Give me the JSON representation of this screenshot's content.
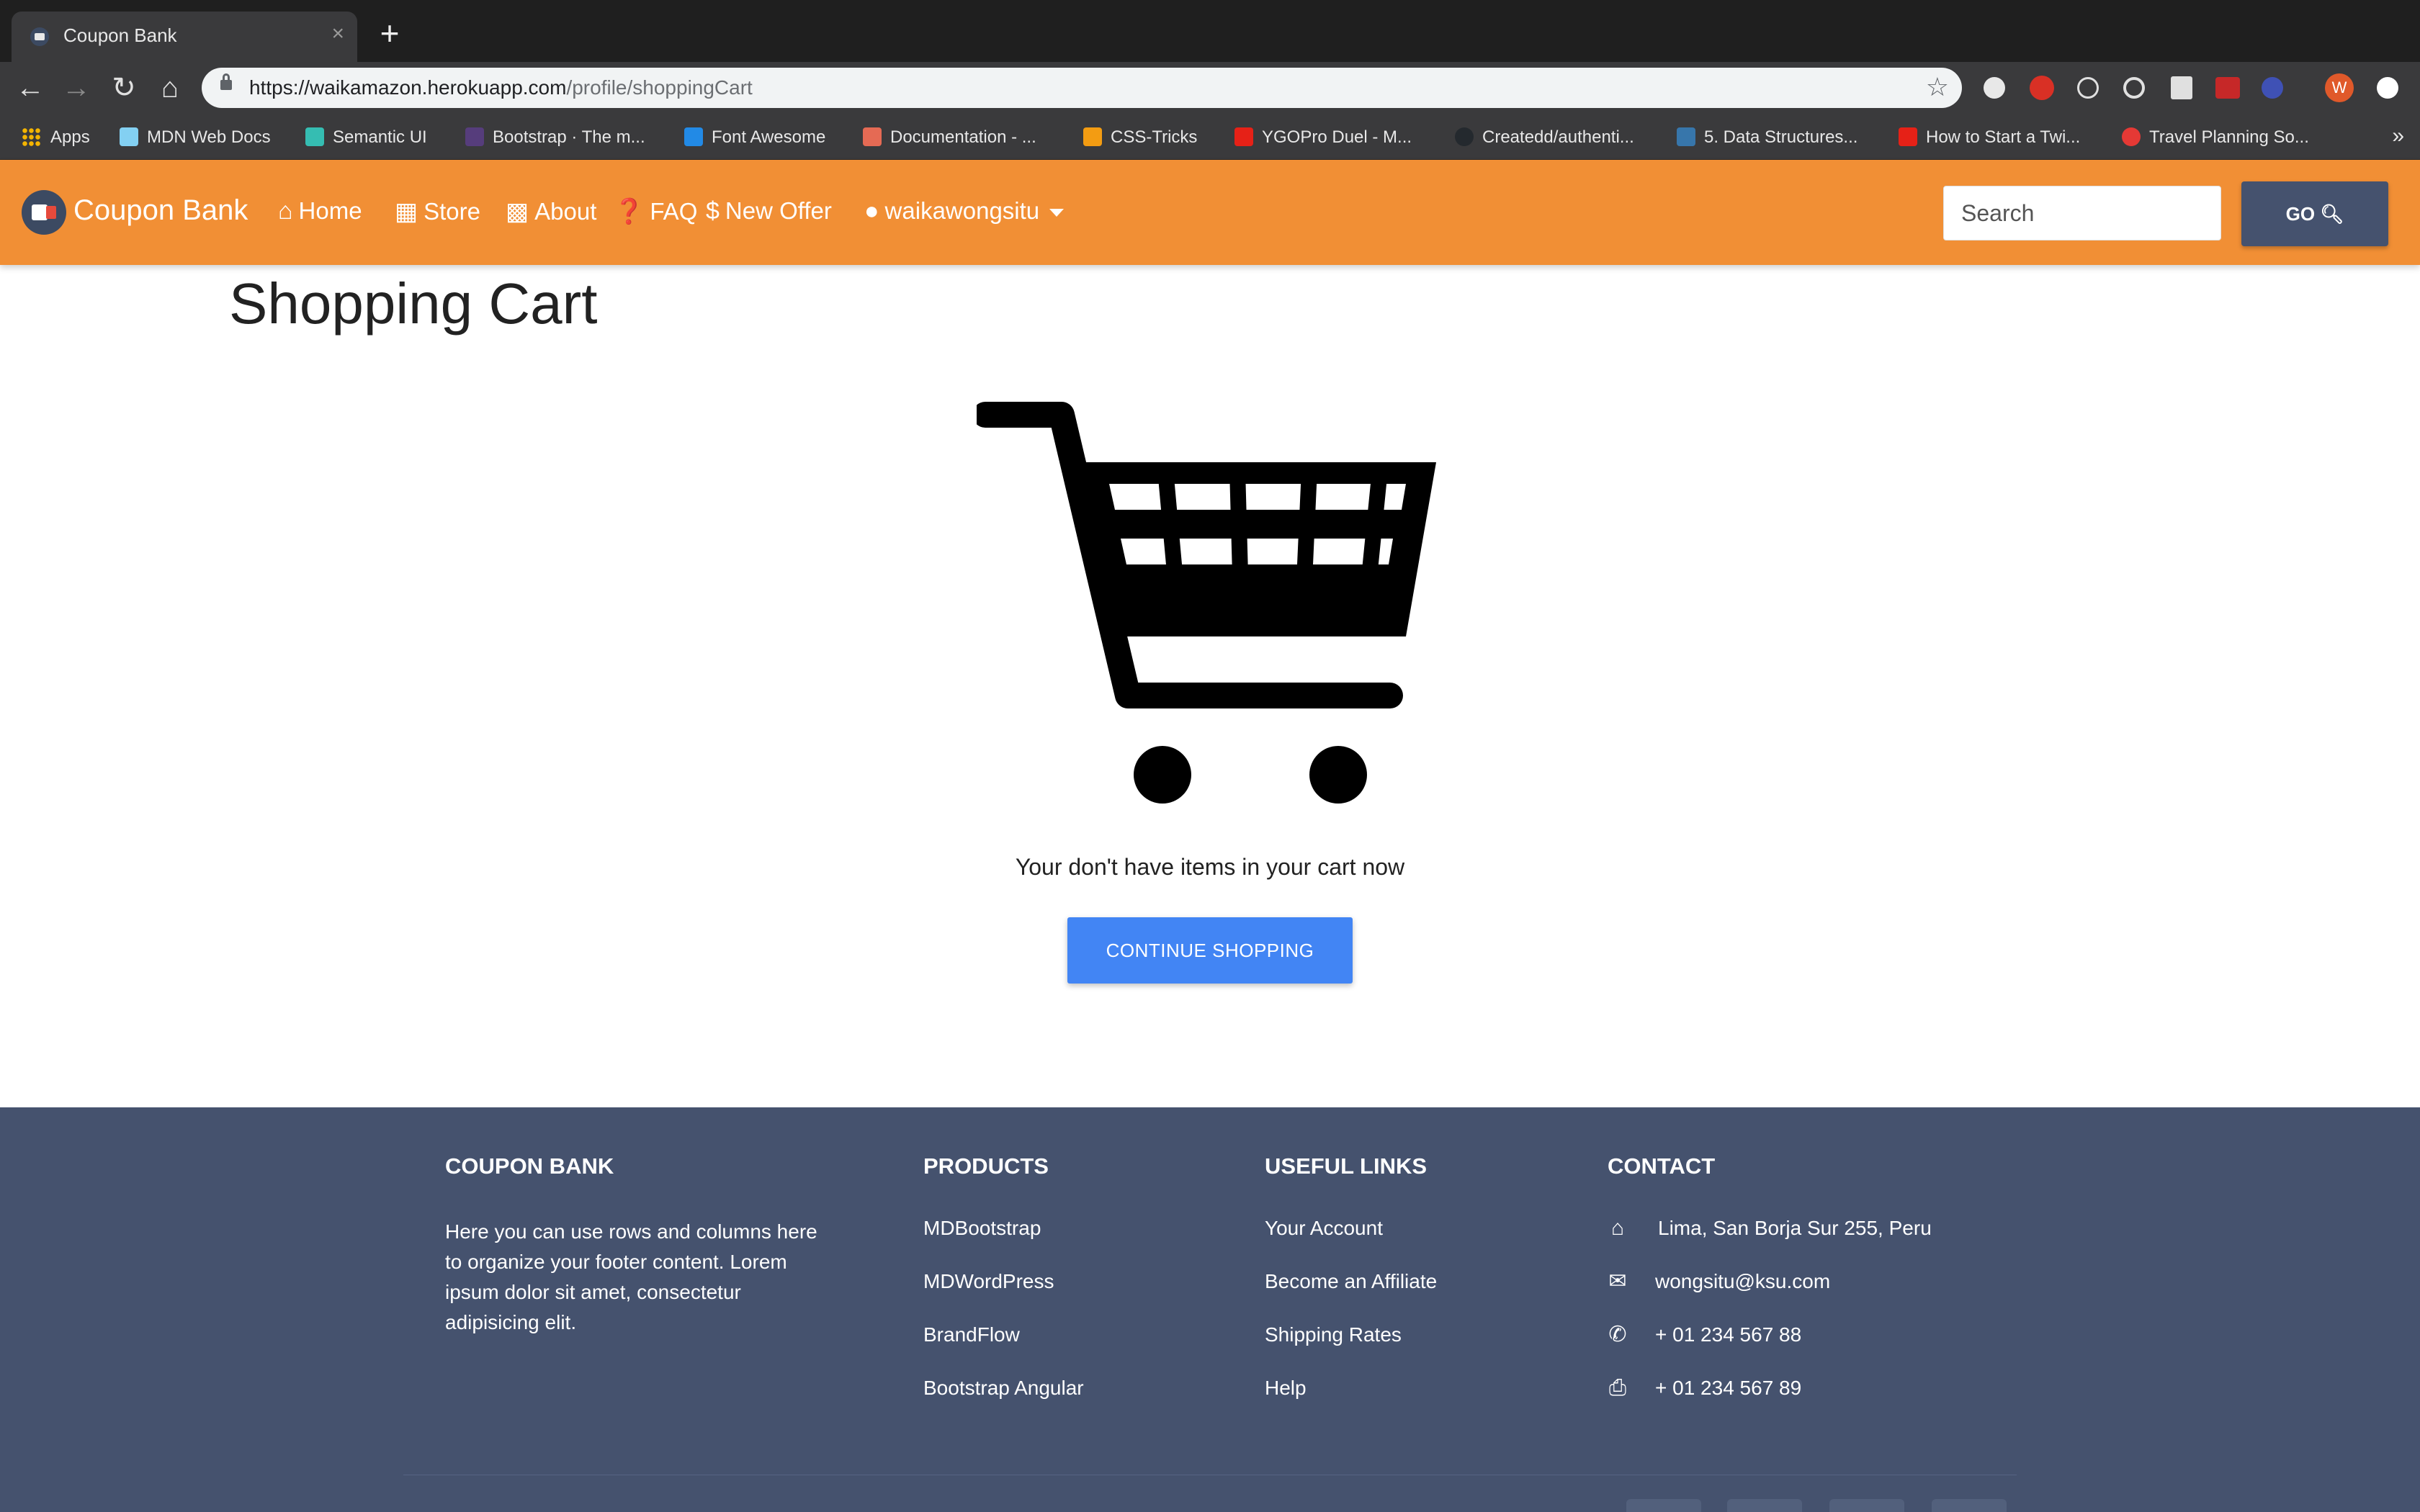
{
  "browser": {
    "tab_title": "Coupon Bank",
    "tab_close": "×",
    "new_tab": "+",
    "url_host": "https://waikamazon.herokuapp.com",
    "url_path": "/profile/shoppingCart",
    "profile_initial": "W",
    "bookmarks": [
      {
        "label": "Apps",
        "color": "#f4b400"
      },
      {
        "label": "MDN Web Docs",
        "color": "#83d0f2"
      },
      {
        "label": "Semantic UI",
        "color": "#35bdb2"
      },
      {
        "label": "Bootstrap · The m...",
        "color": "#563d7c"
      },
      {
        "label": "Font Awesome",
        "color": "#228ae6"
      },
      {
        "label": "Documentation - ...",
        "color": "#e56a54"
      },
      {
        "label": "CSS-Tricks",
        "color": "#f39c12"
      },
      {
        "label": "YGOPro Duel - M...",
        "color": "#e62117"
      },
      {
        "label": "Createdd/authenti...",
        "color": "#24292e"
      },
      {
        "label": "5. Data Structures...",
        "color": "#3776ab"
      },
      {
        "label": "How to Start a Twi...",
        "color": "#e62117"
      },
      {
        "label": "Travel Planning So...",
        "color": "#e53935"
      }
    ],
    "more": "»"
  },
  "navbar": {
    "brand": "Coupon Bank",
    "links": [
      {
        "label": "Home",
        "icon": "home-icon"
      },
      {
        "label": "Store",
        "icon": "store-icon"
      },
      {
        "label": "About",
        "icon": "building-icon"
      },
      {
        "label": "FAQ",
        "icon": "question-icon"
      },
      {
        "label": "New Offer",
        "icon": "hand-dollar-icon"
      },
      {
        "label": "waikawongsitu",
        "icon": "user-icon"
      }
    ],
    "search_placeholder": "Search",
    "go_label": "GO",
    "accent": "#f18f35"
  },
  "main": {
    "title": "Shopping Cart",
    "empty_message": "Your don't have items in your cart now",
    "continue_label": "CONTINUE SHOPPING",
    "button_color": "#4285f4"
  },
  "footer": {
    "bg": "#45526e",
    "about": {
      "heading": "COUPON BANK",
      "text": "Here you can use rows and columns here to organize your footer content. Lorem ipsum dolor sit amet, consectetur adipisicing elit."
    },
    "products": {
      "heading": "PRODUCTS",
      "items": [
        "MDBootstrap",
        "MDWordPress",
        "BrandFlow",
        "Bootstrap Angular"
      ]
    },
    "useful_links": {
      "heading": "USEFUL LINKS",
      "items": [
        "Your Account",
        "Become an Affiliate",
        "Shipping Rates",
        "Help"
      ]
    },
    "contact": {
      "heading": "CONTACT",
      "items": [
        {
          "icon": "home-icon",
          "text": "Lima, San Borja Sur 255, Peru"
        },
        {
          "icon": "envelope-icon",
          "text": "wongsitu@ksu.com"
        },
        {
          "icon": "phone-icon",
          "text": "+ 01 234 567 88"
        },
        {
          "icon": "print-icon",
          "text": "+ 01 234 567 89"
        }
      ]
    }
  }
}
